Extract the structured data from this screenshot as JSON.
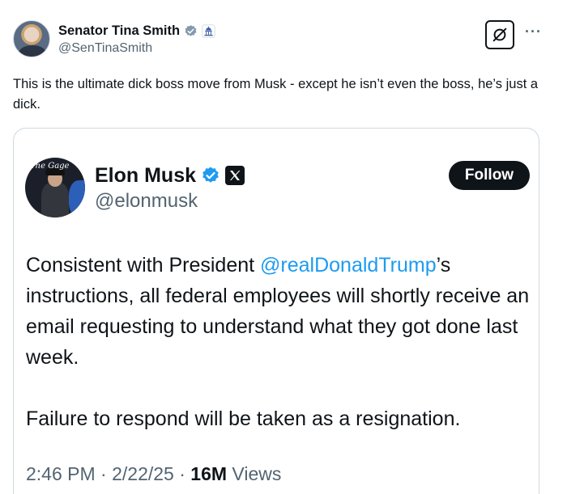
{
  "outer_tweet": {
    "author_name": "Senator Tina Smith",
    "author_handle": "@SenTinaSmith",
    "text": "This is the ultimate dick boss move from Musk - except he isn’t even the boss, he’s just a dick.",
    "icons": [
      "verified-gray-badge-icon",
      "capitol-badge-icon",
      "grok-icon",
      "more-options-icon"
    ]
  },
  "quoted_tweet": {
    "author_name": "Elon Musk",
    "author_handle": "@elonmusk",
    "follow_label": "Follow",
    "avatar_caption": "The Gage",
    "body_part1": "Consistent with President ",
    "mention": "@realDonaldTrump",
    "body_part2": "’s instructions, all federal employees will shortly receive an email requesting to understand what they got done last week.",
    "body_paragraph2": "Failure to respond will be taken as a resignation.",
    "timestamp": "2:46 PM · 2/22/25 · ",
    "views_count": "16M",
    "views_label": " Views",
    "icons": [
      "verified-blue-badge-icon",
      "x-logo-icon"
    ]
  },
  "colors": {
    "text": "#0f1419",
    "secondary": "#536471",
    "link": "#1d9bf0",
    "border": "#cfd9de"
  }
}
